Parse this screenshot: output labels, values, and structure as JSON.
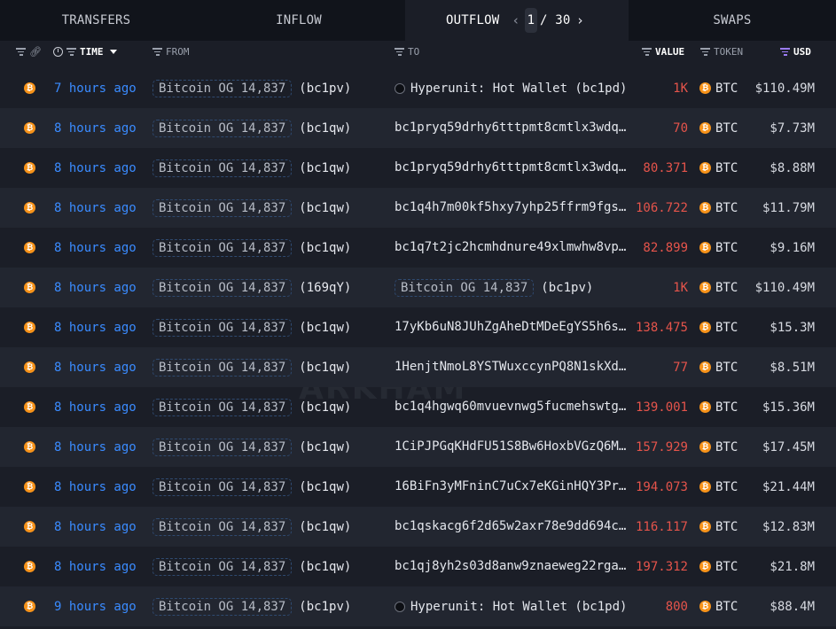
{
  "tabs": [
    {
      "label": "TRANSFERS"
    },
    {
      "label": "INFLOW"
    },
    {
      "label": "OUTFLOW",
      "active": true
    },
    {
      "label": "SWAPS"
    }
  ],
  "pager": {
    "current": "1",
    "rest": "/ 30"
  },
  "header": {
    "time": "TIME",
    "from": "FROM",
    "to": "TO",
    "value": "VALUE",
    "token": "TOKEN",
    "usd": "USD"
  },
  "colors": {
    "time_link": "#3a8bff",
    "value_out": "#e5544b",
    "btc_orange": "#f7931a",
    "usd_filter": "#9b7cf5"
  },
  "watermark": "ARKHAM",
  "rows": [
    {
      "time": "7 hours ago",
      "from_entity": "Bitcoin OG 14,837",
      "from_addr": "(bc1pv)",
      "to_type": "entity-icon",
      "to": "Hyperunit: Hot Wallet (bc1pd)",
      "value": "1K",
      "token": "BTC",
      "usd": "$110.49M"
    },
    {
      "time": "8 hours ago",
      "from_entity": "Bitcoin OG 14,837",
      "from_addr": "(bc1qw)",
      "to_type": "address",
      "to": "bc1pryq59drhy6tttpmt8cmtlx3wdql…",
      "value": "70",
      "token": "BTC",
      "usd": "$7.73M"
    },
    {
      "time": "8 hours ago",
      "from_entity": "Bitcoin OG 14,837",
      "from_addr": "(bc1qw)",
      "to_type": "address",
      "to": "bc1pryq59drhy6tttpmt8cmtlx3wdql…",
      "value": "80.371",
      "token": "BTC",
      "usd": "$8.88M"
    },
    {
      "time": "8 hours ago",
      "from_entity": "Bitcoin OG 14,837",
      "from_addr": "(bc1qw)",
      "to_type": "address",
      "to": "bc1q4h7m00kf5hxy7yhp25ffrm9fgs9…",
      "value": "106.722",
      "token": "BTC",
      "usd": "$11.79M"
    },
    {
      "time": "8 hours ago",
      "from_entity": "Bitcoin OG 14,837",
      "from_addr": "(bc1qw)",
      "to_type": "address",
      "to": "bc1q7t2jc2hcmhdnure49xlmwhw8vpa…",
      "value": "82.899",
      "token": "BTC",
      "usd": "$9.16M"
    },
    {
      "time": "8 hours ago",
      "from_entity": "Bitcoin OG 14,837",
      "from_addr": "(169qY)",
      "to_type": "entity",
      "to_entity": "Bitcoin OG 14,837",
      "to_addr": "(bc1pv)",
      "value": "1K",
      "token": "BTC",
      "usd": "$110.49M"
    },
    {
      "time": "8 hours ago",
      "from_entity": "Bitcoin OG 14,837",
      "from_addr": "(bc1qw)",
      "to_type": "address",
      "to": "17yKb6uN8JUhZgAheDtMDeEgYS5h6sa…",
      "value": "138.475",
      "token": "BTC",
      "usd": "$15.3M"
    },
    {
      "time": "8 hours ago",
      "from_entity": "Bitcoin OG 14,837",
      "from_addr": "(bc1qw)",
      "to_type": "address",
      "to": "1HenjtNmoL8YSTWuxccynPQ8N1skXdf…",
      "value": "77",
      "token": "BTC",
      "usd": "$8.51M"
    },
    {
      "time": "8 hours ago",
      "from_entity": "Bitcoin OG 14,837",
      "from_addr": "(bc1qw)",
      "to_type": "address",
      "to": "bc1q4hgwq60mvuevnwg5fucmehswtg7…",
      "value": "139.001",
      "token": "BTC",
      "usd": "$15.36M"
    },
    {
      "time": "8 hours ago",
      "from_entity": "Bitcoin OG 14,837",
      "from_addr": "(bc1qw)",
      "to_type": "address",
      "to": "1CiPJPGqKHdFU51S8Bw6HoxbVGzQ6Mg…",
      "value": "157.929",
      "token": "BTC",
      "usd": "$17.45M"
    },
    {
      "time": "8 hours ago",
      "from_entity": "Bitcoin OG 14,837",
      "from_addr": "(bc1qw)",
      "to_type": "address",
      "to": "16BiFn3yMFninC7uCx7eKGinHQY3PrS…",
      "value": "194.073",
      "token": "BTC",
      "usd": "$21.44M"
    },
    {
      "time": "8 hours ago",
      "from_entity": "Bitcoin OG 14,837",
      "from_addr": "(bc1qw)",
      "to_type": "address",
      "to": "bc1qskacg6f2d65w2axr78e9dd694cd…",
      "value": "116.117",
      "token": "BTC",
      "usd": "$12.83M"
    },
    {
      "time": "8 hours ago",
      "from_entity": "Bitcoin OG 14,837",
      "from_addr": "(bc1qw)",
      "to_type": "address",
      "to": "bc1qj8yh2s03d8anw9znaeweg22rga6…",
      "value": "197.312",
      "token": "BTC",
      "usd": "$21.8M"
    },
    {
      "time": "9 hours ago",
      "from_entity": "Bitcoin OG 14,837",
      "from_addr": "(bc1pv)",
      "to_type": "entity-icon",
      "to": "Hyperunit: Hot Wallet (bc1pd)",
      "value": "800",
      "token": "BTC",
      "usd": "$88.4M"
    }
  ]
}
